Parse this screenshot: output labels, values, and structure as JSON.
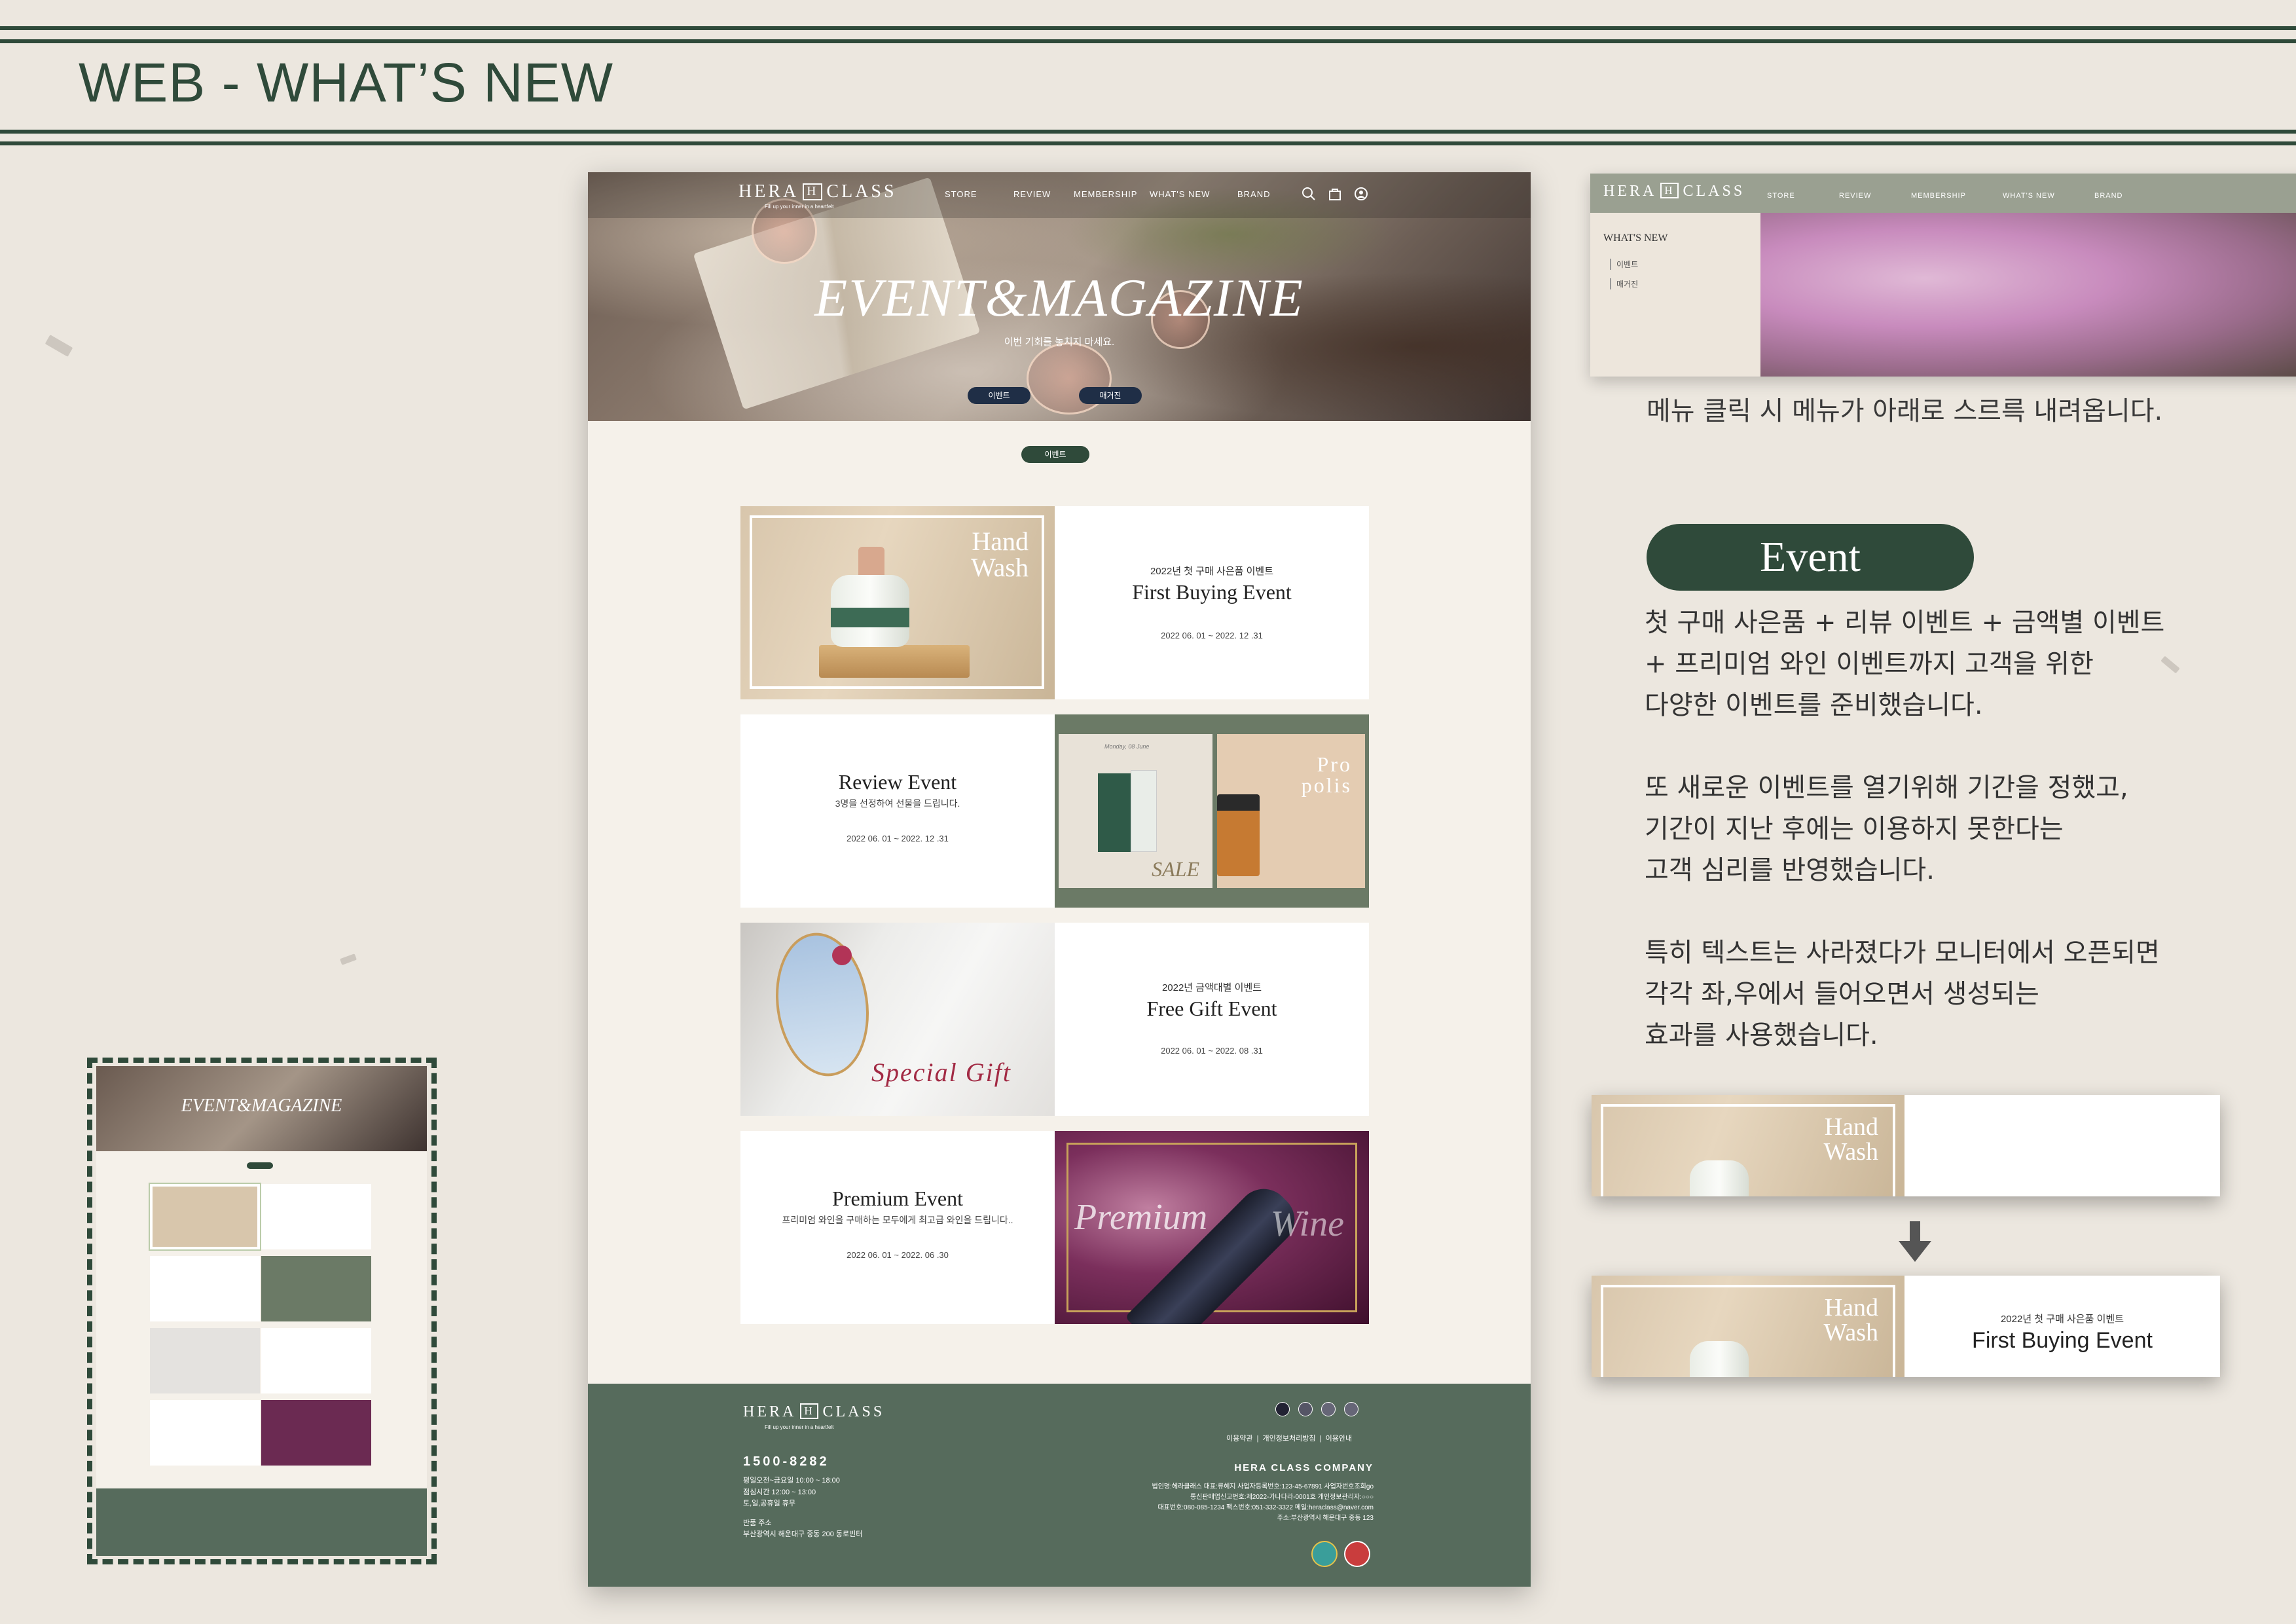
{
  "header": {
    "title": "WEB - WHAT’S NEW"
  },
  "site": {
    "logo": {
      "left": "HERA",
      "box": "H",
      "right": "CLASS",
      "tagline": "Fill up your inner in a heartfelt"
    },
    "nav": [
      "STORE",
      "REVIEW",
      "MEMBERSHIP",
      "WHAT'S NEW",
      "BRAND"
    ],
    "hero": {
      "title": "EVENT&MAGAZINE",
      "subtitle": "이번 기회를 놓치지 마세요.",
      "buttons": [
        "이벤트",
        "매거진"
      ]
    },
    "section_pill": "이벤트",
    "cards": [
      {
        "kicker": "2022년 첫 구매 사은품 이벤트",
        "title": "First Buying Event",
        "date": "2022 06. 01 ~ 2022. 12 .31",
        "image_text": [
          "Hand",
          "Wash"
        ]
      },
      {
        "kicker": "",
        "title": "Review Event",
        "desc": "3명을 선정하여 선물을 드립니다.",
        "date": "2022 06. 01 ~ 2022. 12 .31",
        "image_text": [
          "Pro",
          "polis"
        ],
        "image_sale": "SALE",
        "image_day": "Monday, 08 June"
      },
      {
        "kicker": "2022년 금액대별 이벤트",
        "title": "Free Gift Event",
        "date": "2022 06. 01 ~ 2022. 08 .31",
        "image_text": [
          "Special Gift"
        ]
      },
      {
        "kicker": "",
        "title": "Premium  Event",
        "desc": "프리미엄 와인을 구매하는 모두에게 최고급 와인을 드립니다..",
        "date": "2022 06. 01 ~ 2022. 06 .30",
        "image_text": [
          "Premium",
          "Wine"
        ]
      }
    ],
    "footer": {
      "phone": "1500-8282",
      "hours": [
        "평일오전~금요일 10:00 ~ 18:00",
        "점심시간 12:00 ~ 13:00",
        "토,일,공휴일 휴무"
      ],
      "return_label": "반품 주소",
      "return_addr": "부산광역시 해운대구 중동 200 동로빈터",
      "links": "이용약관  |  개인정보처리방침  |  이용안내",
      "company": "HERA CLASS COMPANY",
      "company_lines": [
        "법인명:헤라클래스    대표:류혜지    사업자등록번호:123-45-67891    사업자번호조회go",
        "통신판매업신고번호:제2022-가나다라-0001호    개인정보관리자:○○○",
        "대표번호:080-085-1234    팩스번호:051-332-3322    메일:heraclass@naver.com",
        "주소:부산광역시 해운대구 중동 123"
      ]
    }
  },
  "right": {
    "nav_panel": {
      "menu_title": "WHAT'S NEW",
      "menu_items": [
        "이벤트",
        "매거진"
      ],
      "caption": "메뉴 클릭 시 메뉴가 아래로 스르륵 내려옵니다."
    },
    "event_pill": "Event",
    "paragraphs": [
      [
        "첫 구매 사은품 + 리뷰 이벤트 + 금액별 이벤트",
        "+ 프리미엄 와인 이벤트까지 고객을 위한",
        "다양한 이벤트를 준비했습니다."
      ],
      [
        "또 새로운 이벤트를 열기위해 기간을 정했고,",
        "기간이 지난 후에는 이용하지 못한다는",
        "고객 심리를 반영했습니다."
      ],
      [
        "특히 텍스트는 사라졌다가 모니터에서 오픈되면",
        "각각 좌,우에서 들어오면서 생성되는",
        "효과를 사용했습니다."
      ]
    ],
    "demo_before": {
      "image_text": [
        "Hand",
        "Wash"
      ]
    },
    "demo_after": {
      "image_text": [
        "Hand",
        "Wash"
      ],
      "kicker": "2022년 첫 구매 사은품 이벤트",
      "title": "First Buying Event"
    }
  },
  "colors": {
    "accent": "#2f4a3a",
    "navy_pill": "#1f2e46",
    "footer": "#566b5c",
    "background": "#ece7df"
  }
}
